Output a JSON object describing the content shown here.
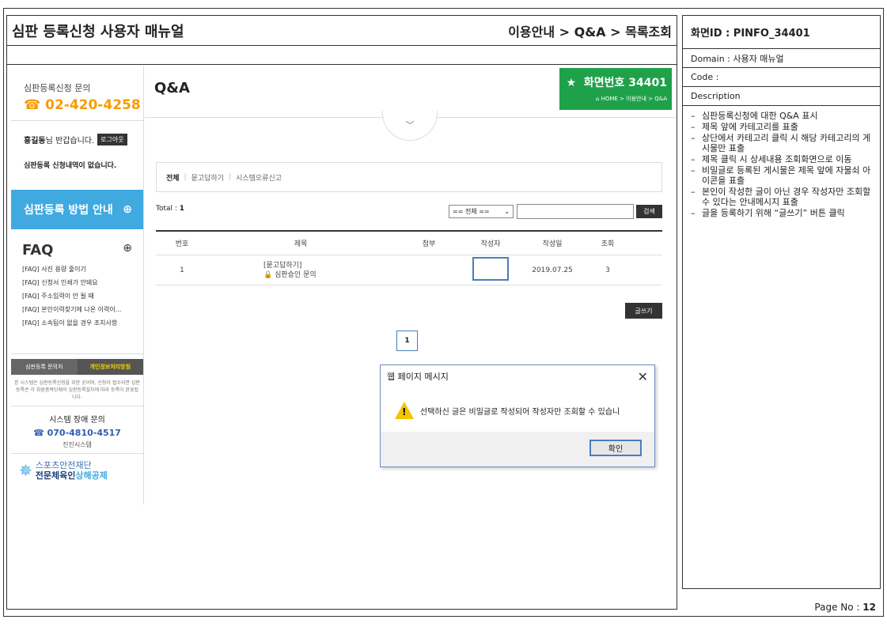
{
  "doc": {
    "title": "심판 등록신청 사용자 매뉴얼",
    "path": "이용안내 > Q&A > 목록조회",
    "screen_id": "화면ID : PINFO_34401",
    "domain": "Domain : 사용자 매뉴얼",
    "code": "Code :",
    "description_label": "Description",
    "description": [
      "심판등록신청에 대한 Q&A 표시",
      "제목 앞에 카테고리를 표출",
      "상단에서 카테고리 클릭 시 해당 카테고리의 게시물만 표출",
      "제목 클릭 시 상세내용 조회화면으로 이동",
      "비밀글로 등록된 게시물은 제목 앞에 자물쇠 아이콘을 표출",
      "본인이 작성한 글이 아닌 경우 작성자만 조회할 수 있다는 안내메시지 표출",
      "글을 등록하기 위해 “글쓰기” 버튼 클릭"
    ],
    "page_label": "Page No :",
    "page_no": "12"
  },
  "sidebar": {
    "contact_label": "심판등록신청 문의",
    "phone": "02-420-4258",
    "user_name": "홍길동",
    "greeting": "님 반갑습니다.",
    "logout": "로그아웃",
    "no_apply": "심판등록 신청내역이 없습니다.",
    "guide": "심판등록 방법 안내",
    "faq_title": "FAQ",
    "faq_items": [
      "[FAQ] 사진 용량 줄이기",
      "[FAQ] 신청서 인쇄가 안돼요",
      "[FAQ] 주소입력이 안 될 때",
      "[FAQ] 본인이력찾기에 나온 이력이...",
      "[FAQ] 소속팀이 없을 경우 조치사항"
    ],
    "tab1": "심판등록 문의처",
    "tab2": "개인정보처리방침",
    "note": "본 시스템은 심판등록신청을 위한 곳이며, 신청이 접수되면 심판등록은 각 회원종목단체의 심판등록절차에 따라 등록이 완료됩니다.",
    "sys_label": "시스템 장애 문의",
    "sys_phone": "070-4810-4517",
    "sys_name": "진진시스템",
    "logo_top": "스포츠안전재단",
    "logo_bot_a": "전문체육인",
    "logo_bot_b": "상해공제"
  },
  "main": {
    "title": "Q&A",
    "badge_num": "화면번호 34401",
    "badge_bc": "HOME > 이용안내 > Q&A",
    "categories": [
      "전체",
      "묻고답하기",
      "시스템오류신고"
    ],
    "total_label": "Total :",
    "total": "1",
    "select_value": "== 전체 ==",
    "search_btn": "검색",
    "columns": [
      "번호",
      "제목",
      "첨부",
      "작성자",
      "작성일",
      "조회"
    ],
    "row": {
      "no": "1",
      "category": "[묻고답하기]",
      "subject": "심판승인 문의",
      "date": "2019.07.25",
      "views": "3"
    },
    "write_btn": "글쓰기",
    "page": "1"
  },
  "dialog": {
    "title": "웹 페이지 메시지",
    "message": "선택하신 글은 비밀글로 작성되어 작성자만 조회할 수 있습니",
    "ok": "확인"
  }
}
